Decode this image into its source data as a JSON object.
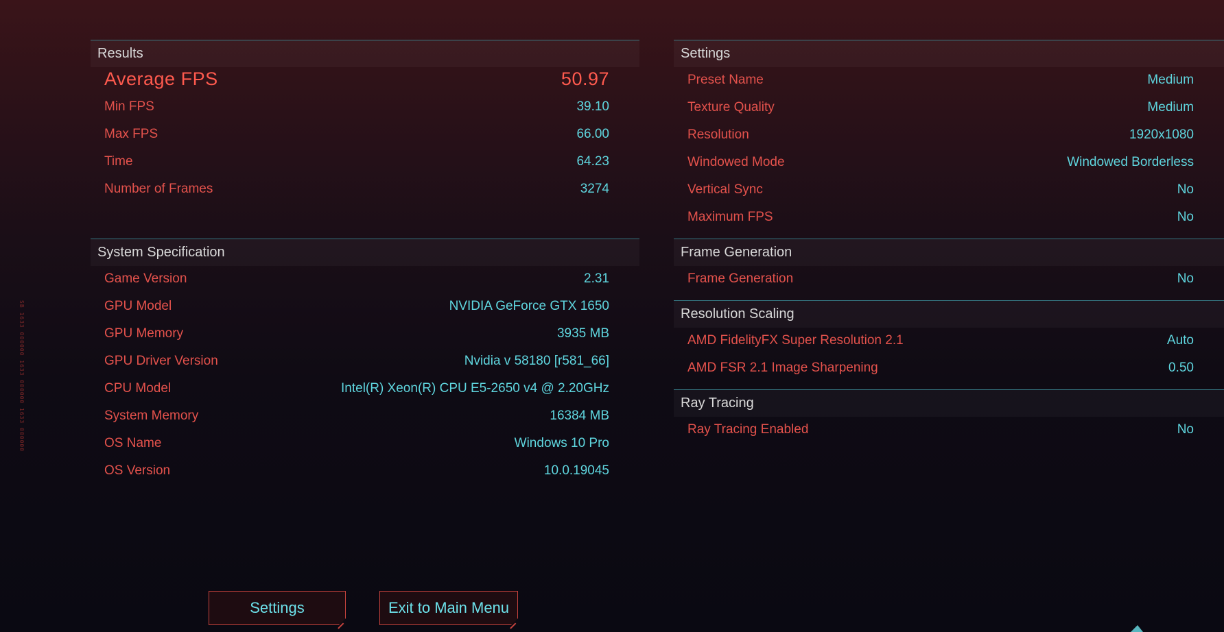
{
  "side_text": "SB 1633 000000 1633 000000 1633 000000 CP",
  "results": {
    "title": "Results",
    "average": {
      "label": "Average FPS",
      "value": "50.97"
    },
    "rows": [
      {
        "label": "Min FPS",
        "value": "39.10"
      },
      {
        "label": "Max FPS",
        "value": "66.00"
      },
      {
        "label": "Time",
        "value": "64.23"
      },
      {
        "label": "Number of Frames",
        "value": "3274"
      }
    ]
  },
  "system": {
    "title": "System Specification",
    "rows": [
      {
        "label": "Game Version",
        "value": "2.31"
      },
      {
        "label": "GPU Model",
        "value": "NVIDIA GeForce GTX 1650"
      },
      {
        "label": "GPU Memory",
        "value": "3935 MB"
      },
      {
        "label": "GPU Driver Version",
        "value": "Nvidia v 58180 [r581_66]"
      },
      {
        "label": "CPU Model",
        "value": "Intel(R) Xeon(R) CPU E5-2650 v4 @ 2.20GHz"
      },
      {
        "label": "System Memory",
        "value": "16384 MB"
      },
      {
        "label": "OS Name",
        "value": "Windows 10 Pro"
      },
      {
        "label": "OS Version",
        "value": "10.0.19045"
      }
    ]
  },
  "settings": {
    "title": "Settings",
    "rows": [
      {
        "label": "Preset Name",
        "value": "Medium"
      },
      {
        "label": "Texture Quality",
        "value": "Medium"
      },
      {
        "label": "Resolution",
        "value": "1920x1080"
      },
      {
        "label": "Windowed Mode",
        "value": "Windowed Borderless"
      },
      {
        "label": "Vertical Sync",
        "value": "No"
      },
      {
        "label": "Maximum FPS",
        "value": "No"
      }
    ]
  },
  "frame_generation": {
    "title": "Frame Generation",
    "rows": [
      {
        "label": "Frame Generation",
        "value": "No"
      }
    ]
  },
  "resolution_scaling": {
    "title": "Resolution Scaling",
    "rows": [
      {
        "label": "AMD FidelityFX Super Resolution 2.1",
        "value": "Auto"
      },
      {
        "label": "AMD FSR 2.1 Image Sharpening",
        "value": "0.50"
      }
    ]
  },
  "ray_tracing": {
    "title": "Ray Tracing",
    "rows": [
      {
        "label": "Ray Tracing Enabled",
        "value": "No"
      }
    ]
  },
  "buttons": {
    "settings": "Settings",
    "exit": "Exit to Main Menu"
  },
  "colors": {
    "label_red": "#e4524c",
    "value_cyan": "#5fd6df",
    "divider_teal": "#3c8b95",
    "button_border": "#c7433d"
  }
}
